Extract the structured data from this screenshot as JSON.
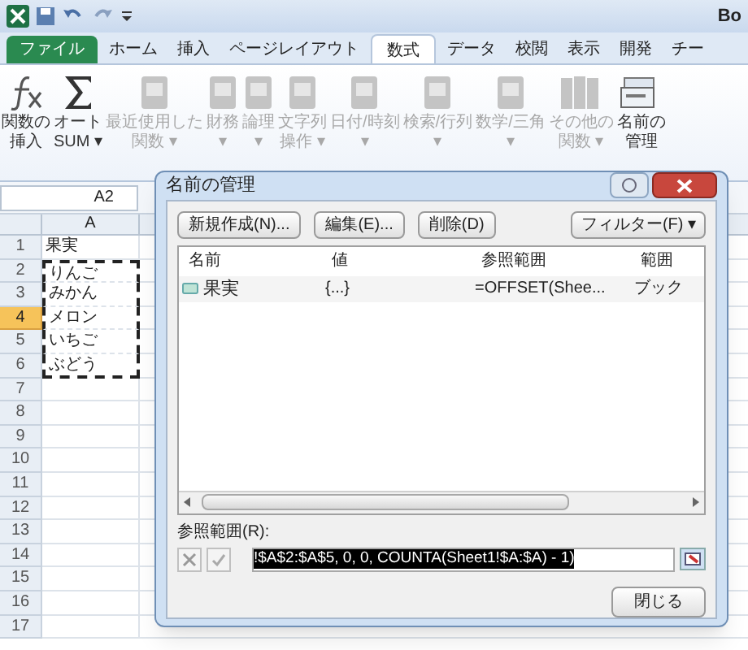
{
  "title_bar": {
    "title": "Bo"
  },
  "tabs": [
    {
      "label": "ファイル",
      "kind": "file",
      "selected": false
    },
    {
      "label": "ホーム",
      "kind": "tab",
      "selected": false
    },
    {
      "label": "挿入",
      "kind": "tab",
      "selected": false
    },
    {
      "label": "ページレイアウト",
      "kind": "tab",
      "selected": false
    },
    {
      "label": "数式",
      "kind": "tab",
      "selected": true
    },
    {
      "label": "データ",
      "kind": "tab",
      "selected": false
    },
    {
      "label": "校閲",
      "kind": "tab",
      "selected": false
    },
    {
      "label": "表示",
      "kind": "tab",
      "selected": false
    },
    {
      "label": "開発",
      "kind": "tab",
      "selected": false
    },
    {
      "label": "チー",
      "kind": "tab",
      "selected": false
    }
  ],
  "ribbon": [
    {
      "kind": "fx",
      "lines": [
        "関数の",
        "挿入"
      ],
      "disabled": false
    },
    {
      "kind": "sum",
      "lines": [
        "オート",
        "SUM ▾"
      ],
      "disabled": false
    },
    {
      "kind": "book",
      "lines": [
        "最近使用した",
        "関数 ▾"
      ],
      "disabled": true
    },
    {
      "kind": "book",
      "lines": [
        "財務",
        "▾"
      ],
      "disabled": true
    },
    {
      "kind": "book",
      "lines": [
        "論理",
        "▾"
      ],
      "disabled": true
    },
    {
      "kind": "book",
      "lines": [
        "文字列",
        "操作 ▾"
      ],
      "disabled": true
    },
    {
      "kind": "book",
      "lines": [
        "日付/時刻",
        "▾"
      ],
      "disabled": true
    },
    {
      "kind": "book",
      "lines": [
        "検索/行列",
        "▾"
      ],
      "disabled": true
    },
    {
      "kind": "book",
      "lines": [
        "数学/三角",
        "▾"
      ],
      "disabled": true
    },
    {
      "kind": "books",
      "lines": [
        "その他の",
        "関数 ▾"
      ],
      "disabled": true
    },
    {
      "kind": "names",
      "lines": [
        "名前の",
        "管理"
      ],
      "disabled": false
    }
  ],
  "name_box": "A2",
  "sheet": {
    "column": "A",
    "rows": [
      {
        "number": "1",
        "value": "果実",
        "selected": false,
        "marked": false
      },
      {
        "number": "2",
        "value": "りんご",
        "selected": false,
        "marked": true
      },
      {
        "number": "3",
        "value": "みかん",
        "selected": false,
        "marked": true
      },
      {
        "number": "4",
        "value": "メロン",
        "selected": true,
        "marked": true
      },
      {
        "number": "5",
        "value": "いちご",
        "selected": false,
        "marked": true
      },
      {
        "number": "6",
        "value": "ぶどう",
        "selected": false,
        "marked": true
      },
      {
        "number": "7",
        "value": "",
        "selected": false,
        "marked": false
      },
      {
        "number": "8",
        "value": "",
        "selected": false,
        "marked": false
      },
      {
        "number": "9",
        "value": "",
        "selected": false,
        "marked": false
      },
      {
        "number": "10",
        "value": "",
        "selected": false,
        "marked": false
      },
      {
        "number": "11",
        "value": "",
        "selected": false,
        "marked": false
      },
      {
        "number": "12",
        "value": "",
        "selected": false,
        "marked": false
      },
      {
        "number": "13",
        "value": "",
        "selected": false,
        "marked": false
      },
      {
        "number": "14",
        "value": "",
        "selected": false,
        "marked": false
      },
      {
        "number": "15",
        "value": "",
        "selected": false,
        "marked": false
      },
      {
        "number": "16",
        "value": "",
        "selected": false,
        "marked": false
      },
      {
        "number": "17",
        "value": "",
        "selected": false,
        "marked": false
      }
    ]
  },
  "dialog": {
    "title": "名前の管理",
    "buttons": [
      "新規作成(N)...",
      "編集(E)...",
      "削除(D)"
    ],
    "filter": "フィルター(F) ▾",
    "columns": [
      "名前",
      "値",
      "参照範囲",
      "範囲"
    ],
    "rows": [
      {
        "name": "果実",
        "value": "{...}",
        "refers_to": "=OFFSET(Shee...",
        "scope": "ブック"
      }
    ],
    "ref_label": "参照範囲(R):",
    "ref_value": "!$A$2:$A$5, 0, 0, COUNTA(Sheet1!$A:$A) - 1)",
    "close": "閉じる"
  }
}
